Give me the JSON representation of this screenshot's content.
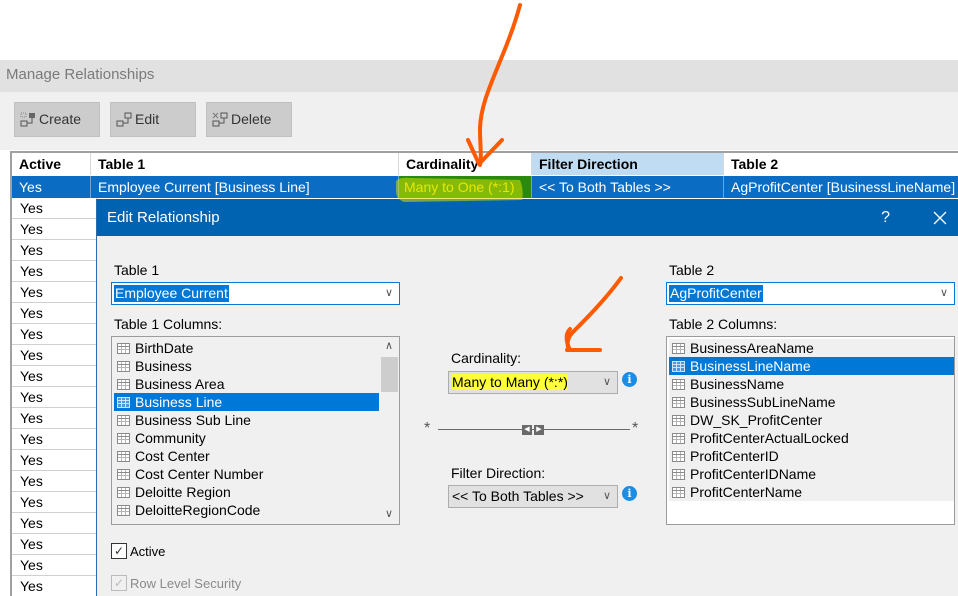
{
  "manage_relationships": {
    "title": "Manage Relationships",
    "toolbar": {
      "create_label": "Create",
      "edit_label": "Edit",
      "delete_label": "Delete"
    },
    "grid": {
      "columns": [
        "Active",
        "Table 1",
        "Cardinality",
        "Filter Direction",
        "Table 2"
      ],
      "selected_row": {
        "active": "Yes",
        "table1": "Employee Current [Business Line]",
        "cardinality": "Many to One (*:1)",
        "filter_direction": "<< To Both Tables >>",
        "table2": "AgProfitCenter [BusinessLineName]"
      },
      "other_rows_active": [
        "Yes",
        "Yes",
        "Yes",
        "Yes",
        "Yes",
        "Yes",
        "Yes",
        "Yes",
        "Yes",
        "Yes",
        "Yes",
        "Yes",
        "Yes",
        "Yes",
        "Yes",
        "Yes",
        "Yes",
        "Yes",
        "Yes"
      ]
    }
  },
  "edit_relationship": {
    "title": "Edit Relationship",
    "help_label": "?",
    "close_label": "X",
    "table1": {
      "label": "Table 1",
      "value": "Employee Current",
      "columns_label": "Table 1 Columns:",
      "columns": [
        "BirthDate",
        "Business",
        "Business Area",
        "Business Line",
        "Business Sub Line",
        "Community",
        "Cost Center",
        "Cost Center Number",
        "Deloitte Region",
        "DeloitteRegionCode"
      ],
      "selected": "Business Line"
    },
    "table2": {
      "label": "Table 2",
      "value": "AgProfitCenter",
      "columns_label": "Table 2 Columns:",
      "columns": [
        "BusinessAreaName",
        "BusinessLineName",
        "BusinessName",
        "BusinessSubLineName",
        "DW_SK_ProfitCenter",
        "ProfitCenterActualLocked",
        "ProfitCenterID",
        "ProfitCenterIDName",
        "ProfitCenterName"
      ],
      "selected": "BusinessLineName"
    },
    "cardinality": {
      "label": "Cardinality:",
      "value": "Many to Many (*:*)",
      "left_symbol": "*",
      "right_symbol": "*"
    },
    "filter_direction": {
      "label": "Filter Direction:",
      "value": "<< To Both Tables >>"
    },
    "active": {
      "label": "Active",
      "checked": true
    },
    "row_level_security": {
      "label": "Row Level Security",
      "checked": true,
      "disabled": true
    }
  },
  "annotations": {
    "arrow_color": "#ff5a00",
    "highlight_color": "#ffff3a"
  }
}
